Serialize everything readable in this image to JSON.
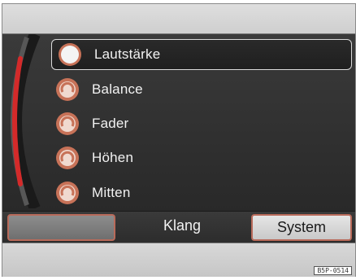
{
  "menu": {
    "items": [
      {
        "label": "Lautstärke",
        "icon": "volume-knob-icon",
        "selected": true
      },
      {
        "label": "Balance",
        "icon": "balance-knob-icon",
        "selected": false
      },
      {
        "label": "Fader",
        "icon": "fader-knob-icon",
        "selected": false
      },
      {
        "label": "Höhen",
        "icon": "treble-knob-icon",
        "selected": false
      },
      {
        "label": "Mitten",
        "icon": "mid-knob-icon",
        "selected": false
      }
    ]
  },
  "softkeys": {
    "left_label": "",
    "center_label": "Klang",
    "right_label": "System"
  },
  "figure_code": "B5P-0514",
  "colors": {
    "accent_red": "#d42a2a",
    "softkey_border": "#b86a5a",
    "screen_bg": "#2e2e2e"
  }
}
